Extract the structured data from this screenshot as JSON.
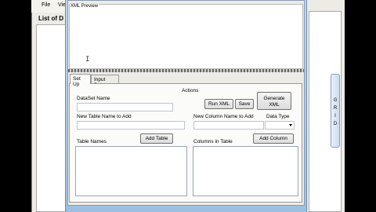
{
  "main": {
    "menu": [
      {
        "label": "File"
      },
      {
        "label": "Vie"
      }
    ],
    "heading": "List of D",
    "grid_letters": [
      "G",
      "R",
      "I",
      "D"
    ]
  },
  "dialog": {
    "xml_preview_label": "XML Preview",
    "text_cursor": "I",
    "tabs": [
      {
        "label": "Set Up"
      },
      {
        "label": "Input Data"
      }
    ],
    "setup": {
      "actions_label": "Actions",
      "run_xml_label": "Run XML",
      "save_label": "Save",
      "generate_xml_line1": "Generate",
      "generate_xml_line2": "XML",
      "dataset_name_label": "DataSet Name",
      "new_table_name_label": "New Table Name to Add",
      "new_column_name_label": "New Column Name to Add",
      "data_type_label": "Data Type",
      "table_names_label": "Table Names",
      "add_table_label": "Add Table",
      "columns_in_table_label": "Columns in Table",
      "add_column_label": "Add Column"
    }
  }
}
